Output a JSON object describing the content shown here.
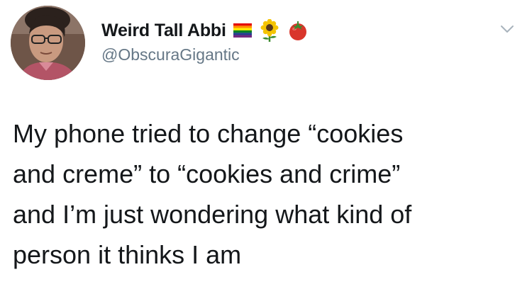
{
  "author": {
    "display_name": "Weird Tall Abbi",
    "handle": "@ObscuraGigantic",
    "name_emojis": [
      "rainbow-flag-icon",
      "sunflower-icon",
      "tomato-icon"
    ]
  },
  "menu": {
    "icon": "chevron-down-icon"
  },
  "tweet": {
    "lines": [
      "My phone tried to change “cookies",
      "and creme” to “cookies and crime”",
      "and I’m just wondering what kind of",
      "person it thinks I am"
    ]
  },
  "colors": {
    "name": "#14171a",
    "handle": "#657786",
    "background": "#ffffff"
  }
}
